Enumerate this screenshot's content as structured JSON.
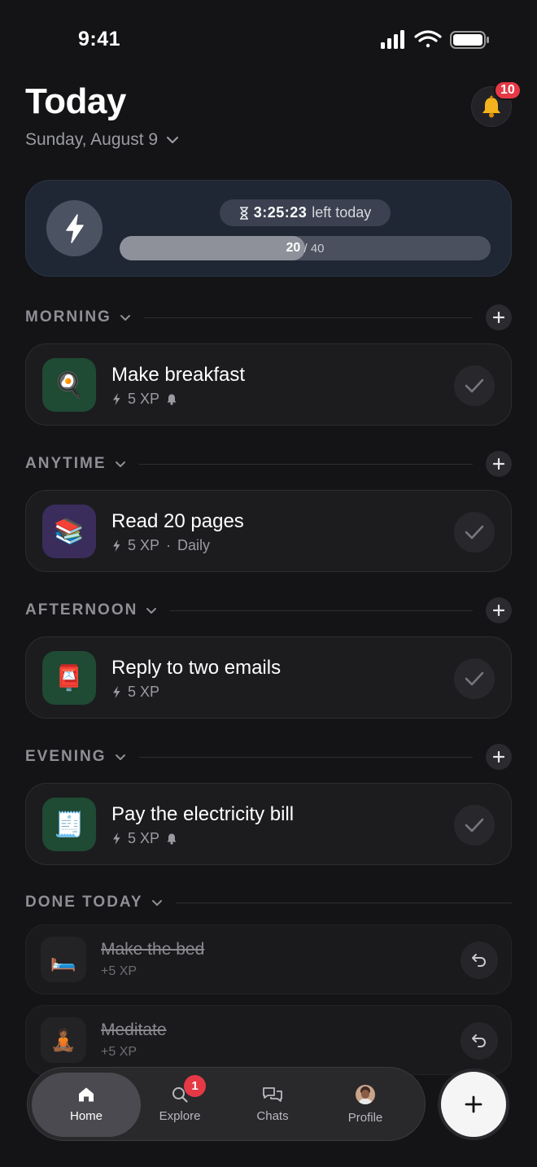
{
  "status_bar": {
    "time": "9:41"
  },
  "header": {
    "title": "Today",
    "date": "Sunday, August 9",
    "notifications_count": "10"
  },
  "progress": {
    "timer_value": "3:25:23",
    "timer_suffix": "left today",
    "current": "20",
    "separator": " / ",
    "total": "40",
    "fill_fraction": 0.5
  },
  "sections": [
    {
      "title": "MORNING",
      "task": {
        "title": "Make breakfast",
        "xp": "5 XP",
        "extra": "",
        "has_reminder": true,
        "icon": "frying-pan-icon",
        "emoji": "🍳",
        "icon_bg": "#1f4a33"
      }
    },
    {
      "title": "ANYTIME",
      "task": {
        "title": "Read 20 pages",
        "xp": "5 XP",
        "extra": "Daily",
        "has_reminder": false,
        "icon": "books-icon",
        "emoji": "📚",
        "icon_bg": "#3a2d5c"
      }
    },
    {
      "title": "AFTERNOON",
      "task": {
        "title": "Reply to two emails",
        "xp": "5 XP",
        "extra": "",
        "has_reminder": false,
        "icon": "postbox-icon",
        "emoji": "📮",
        "icon_bg": "#1f4a33"
      }
    },
    {
      "title": "EVENING",
      "task": {
        "title": "Pay the electricity bill",
        "xp": "5 XP",
        "extra": "",
        "has_reminder": true,
        "icon": "receipt-icon",
        "emoji": "🧾",
        "icon_bg": "#1f4a33"
      }
    }
  ],
  "done_today": {
    "title": "DONE TODAY",
    "items": [
      {
        "title": "Make the bed",
        "xp": "+5 XP",
        "icon": "bed-icon",
        "emoji": "🛏️"
      },
      {
        "title": "Meditate",
        "xp": "+5 XP",
        "icon": "meditation-icon",
        "emoji": "🧘🏾"
      }
    ]
  },
  "tabbar": {
    "tabs": [
      {
        "label": "Home",
        "icon": "home-icon",
        "active": true
      },
      {
        "label": "Explore",
        "icon": "search-icon",
        "badge": "1"
      },
      {
        "label": "Chats",
        "icon": "chat-bubbles-icon"
      },
      {
        "label": "Profile",
        "icon": "avatar"
      }
    ]
  },
  "colors": {
    "background": "#141416",
    "progress_card": "#1f2734",
    "badge_red": "#e53946",
    "fab": "#f5f5f5"
  }
}
